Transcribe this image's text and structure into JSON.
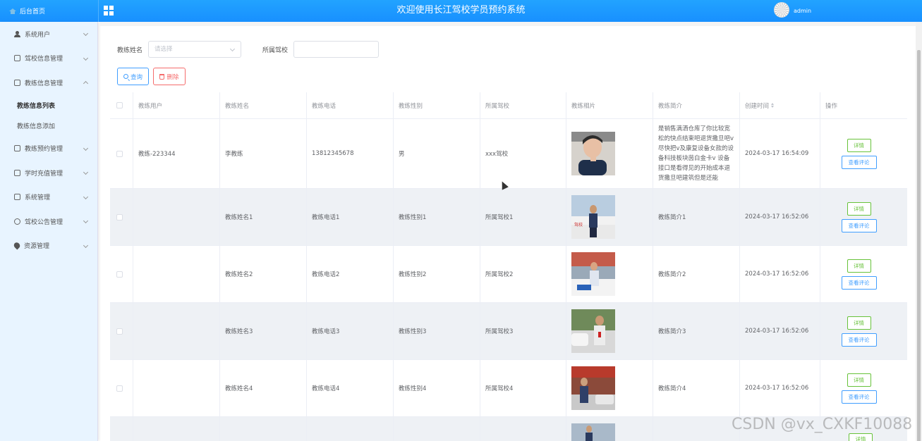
{
  "header": {
    "home_label": "后台首页",
    "title": "欢迎使用长江驾校学员预约系统",
    "user": "admin"
  },
  "sidebar": {
    "items": [
      {
        "label": "系统用户",
        "icon": "user-icon"
      },
      {
        "label": "驾校信息管理",
        "icon": "edit-icon"
      },
      {
        "label": "教练信息管理",
        "icon": "edit-icon",
        "expanded": true
      },
      {
        "label": "教练预约管理",
        "icon": "edit-icon"
      },
      {
        "label": "学时充值管理",
        "icon": "edit-icon"
      },
      {
        "label": "系统管理",
        "icon": "image-icon"
      },
      {
        "label": "驾校公告管理",
        "icon": "info-icon"
      },
      {
        "label": "资源管理",
        "icon": "pin-icon"
      }
    ],
    "sub_items": [
      {
        "label": "教练信息列表",
        "active": true
      },
      {
        "label": "教练信息添加",
        "active": false
      }
    ]
  },
  "search": {
    "name_label": "教练姓名",
    "name_placeholder": "请选择",
    "school_label": "所属驾校",
    "school_value": "",
    "query_button": "查询",
    "delete_button": "删除"
  },
  "table": {
    "columns": [
      "教练用户",
      "教练姓名",
      "教练电话",
      "教练性别",
      "所属驾校",
      "教练相片",
      "教练简介",
      "创建时间",
      "操作"
    ],
    "detail_label": "详情",
    "review_label": "查看评论",
    "rows": [
      {
        "user": "教练-223344",
        "name": "李教练",
        "phone": "13812345678",
        "gender": "男",
        "school": "xxx驾校",
        "intro": "是销售满洒仓库了你比较宽松的快点结束吧退货撒旦吧v尽快把v及康复设备女款的设备科技板块茵白金卡v 设备接口是看得见的开始成本退货撒旦吧建筑但是还能",
        "created": "2024-03-17 16:54:09"
      },
      {
        "user": "",
        "name": "教练姓名1",
        "phone": "教练电话1",
        "gender": "教练性别1",
        "school": "所属驾校1",
        "intro": "教练简介1",
        "created": "2024-03-17 16:52:06"
      },
      {
        "user": "",
        "name": "教练姓名2",
        "phone": "教练电话2",
        "gender": "教练性别2",
        "school": "所属驾校2",
        "intro": "教练简介2",
        "created": "2024-03-17 16:52:06"
      },
      {
        "user": "",
        "name": "教练姓名3",
        "phone": "教练电话3",
        "gender": "教练性别3",
        "school": "所属驾校3",
        "intro": "教练简介3",
        "created": "2024-03-17 16:52:06"
      },
      {
        "user": "",
        "name": "教练姓名4",
        "phone": "教练电话4",
        "gender": "教练性别4",
        "school": "所属驾校4",
        "intro": "教练简介4",
        "created": "2024-03-17 16:52:06"
      }
    ]
  },
  "watermark": "CSDN @vx_CXKF10088"
}
